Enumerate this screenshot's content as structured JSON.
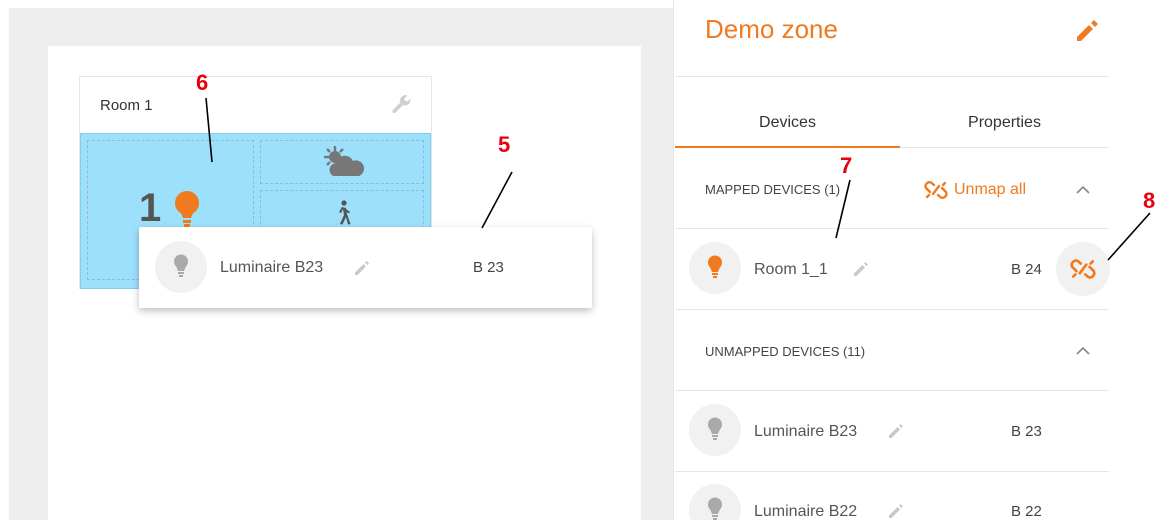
{
  "canvas": {
    "room_title": "Room 1",
    "room_device_count": "1"
  },
  "drag_card": {
    "name": "Luminaire B23",
    "code": "B 23"
  },
  "zone": {
    "title": "Demo zone"
  },
  "tabs": [
    {
      "label": "Devices",
      "active": true
    },
    {
      "label": "Properties",
      "active": false
    }
  ],
  "mapped": {
    "title": "MAPPED DEVICES (1)",
    "unmap_all_label": "Unmap all",
    "items": [
      {
        "name": "Room 1_1",
        "code": "B 24",
        "icon": "bulb-orange-icon"
      }
    ]
  },
  "unmapped": {
    "title": "UNMAPPED DEVICES (11)",
    "items": [
      {
        "name": "Luminaire B23",
        "code": "B 23",
        "icon": "bulb-grey-icon"
      },
      {
        "name": "Luminaire B22",
        "code": "B 22",
        "icon": "bulb-grey-icon"
      }
    ]
  },
  "annotations": [
    "6",
    "5",
    "7",
    "8"
  ],
  "colors": {
    "accent": "#f07a1f",
    "room_fill": "#9de0fb",
    "annotation": "#e8000e"
  }
}
